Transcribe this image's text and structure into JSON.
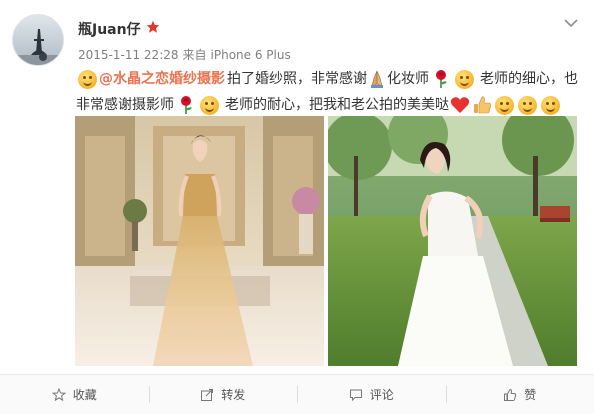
{
  "post": {
    "username": "瓶Juan仔",
    "verified_icon": "red-star-badge-icon",
    "timestamp": "2015-1-11 22:28",
    "source_prefix": "来自",
    "source_device": "iPhone 6 Plus",
    "menu_icon": "chevron-down-icon",
    "text": {
      "mention": "@水晶之恋婚纱摄影",
      "segment_1": "拍了婚纱照，非常感谢",
      "segment_2": "化妆师",
      "segment_3": "老师的细心，也",
      "segment_4": "非常感谢摄影师",
      "segment_5": "老师的耐心，把我和老公拍的美美哒"
    },
    "emoji_icons": [
      "smile-icon",
      "pray-icon",
      "rose-icon",
      "heart-icon",
      "thumbs-up-icon"
    ],
    "photos": [
      {
        "description": "bride-in-gold-gown-indoor"
      },
      {
        "description": "bride-in-white-dress-park"
      }
    ]
  },
  "actions": {
    "favorite_label": "收藏",
    "repost_label": "转发",
    "comment_label": "评论",
    "like_label": "赞"
  },
  "colors": {
    "mention": "#eb7350",
    "text": "#333333",
    "meta": "#808080",
    "toolbar_bg": "#fafafa"
  }
}
